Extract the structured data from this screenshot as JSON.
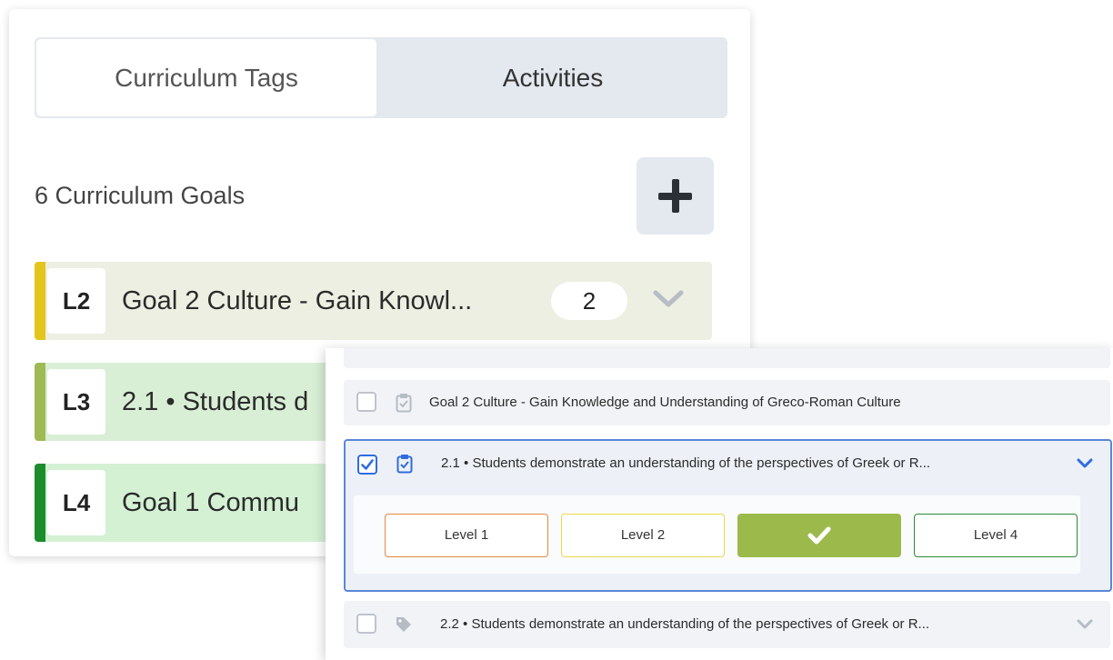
{
  "tabs": {
    "curriculum_tags": "Curriculum Tags",
    "activities": "Activities"
  },
  "goals_header": {
    "count_label": "6 Curriculum Goals",
    "add_icon": "plus-icon"
  },
  "goal_rows": [
    {
      "level": "L2",
      "title": "Goal 2 Culture - Gain Knowl...",
      "count": "2",
      "bar_color": "#e3c51b",
      "bg_color": "#ecefe1"
    },
    {
      "level": "L3",
      "title": "2.1 • Students d",
      "bar_color": "#9fba55",
      "bg_color": "#d8efd5"
    },
    {
      "level": "L4",
      "title": "Goal 1 Commu",
      "bar_color": "#1c8c2c",
      "bg_color": "#d4f1d4"
    }
  ],
  "overlay": {
    "items": [
      {
        "text": "Goal 2 Culture - Gain Knowledge and Understanding of Greco-Roman Culture",
        "checked": false,
        "icon": "clipboard-check-icon"
      },
      {
        "text": "2.1 • Students demonstrate an understanding of the perspectives of Greek or R...",
        "checked": true,
        "icon": "clipboard-check-icon",
        "expanded": true
      },
      {
        "text": "2.2 • Students demonstrate an understanding of the perspectives of Greek or R...",
        "checked": false,
        "icon": "tag-icon"
      }
    ],
    "levels": {
      "level1": "Level 1",
      "level2": "Level 2",
      "level3_selected_icon": "checkmark-icon",
      "level4": "Level 4"
    },
    "colors": {
      "accent_blue": "#2f6ce0",
      "level1_border": "#e3883d",
      "level2_border": "#e9d94a",
      "level3_fill": "#9cba4b",
      "level4_border": "#2e8a34"
    }
  }
}
